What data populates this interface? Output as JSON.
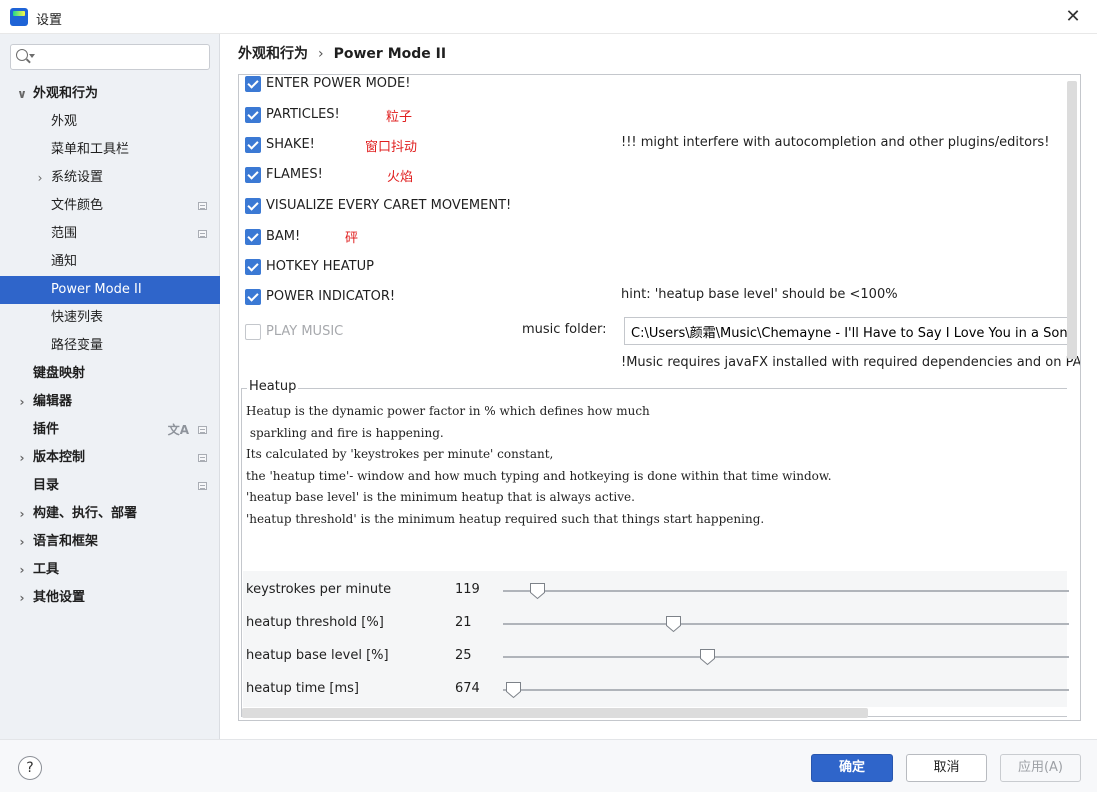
{
  "window": {
    "title": "设置",
    "close_icon": "close-icon"
  },
  "search": {
    "placeholder": "",
    "value": ""
  },
  "sidebar": {
    "items": [
      {
        "label": "外观和行为",
        "level": 0,
        "expanded": true,
        "bold": true
      },
      {
        "label": "外观",
        "level": 1
      },
      {
        "label": "菜单和工具栏",
        "level": 1
      },
      {
        "label": "系统设置",
        "level": 1,
        "collapsed": true
      },
      {
        "label": "文件颜色",
        "level": 1,
        "badge": true
      },
      {
        "label": "范围",
        "level": 1,
        "badge": true
      },
      {
        "label": "通知",
        "level": 1
      },
      {
        "label": "Power Mode II",
        "level": 1,
        "selected": true
      },
      {
        "label": "快速列表",
        "level": 1
      },
      {
        "label": "路径变量",
        "level": 1
      },
      {
        "label": "键盘映射",
        "level": 0,
        "bold": true
      },
      {
        "label": "编辑器",
        "level": 0,
        "collapsed": true,
        "bold": true
      },
      {
        "label": "插件",
        "level": 0,
        "bold": true,
        "badge": true,
        "translate_icon": "文A"
      },
      {
        "label": "版本控制",
        "level": 0,
        "collapsed": true,
        "bold": true,
        "badge": true
      },
      {
        "label": "目录",
        "level": 0,
        "bold": true,
        "badge": true
      },
      {
        "label": "构建、执行、部署",
        "level": 0,
        "collapsed": true,
        "bold": true
      },
      {
        "label": "语言和框架",
        "level": 0,
        "collapsed": true,
        "bold": true
      },
      {
        "label": "工具",
        "level": 0,
        "collapsed": true,
        "bold": true
      },
      {
        "label": "其他设置",
        "level": 0,
        "collapsed": true,
        "bold": true
      }
    ]
  },
  "breadcrumb": {
    "parent": "外观和行为",
    "separator": "›",
    "current": "Power Mode II"
  },
  "options": {
    "enter_power_mode": {
      "label": "ENTER POWER MODE!",
      "checked": true
    },
    "particles": {
      "label": "PARTICLES!",
      "checked": true,
      "annotation": "粒子"
    },
    "shake": {
      "label": "SHAKE!",
      "checked": true,
      "annotation": "窗口抖动",
      "note": "!!! might interfere with autocompletion and other plugins/editors!"
    },
    "flames": {
      "label": "FLAMES!",
      "checked": true,
      "annotation": "火焰"
    },
    "visualize_caret": {
      "label": "VISUALIZE EVERY CARET MOVEMENT!",
      "checked": true
    },
    "bam": {
      "label": "BAM!",
      "checked": true,
      "annotation": "砰"
    },
    "hotkey_heatup": {
      "label": "HOTKEY HEATUP",
      "checked": true
    },
    "power_indicator": {
      "label": "POWER INDICATOR!",
      "checked": true,
      "note": "hint: 'heatup base level' should be <100%"
    },
    "play_music": {
      "label": "PLAY MUSIC",
      "checked": false,
      "disabled": true
    }
  },
  "music": {
    "folder_label": "music folder:",
    "folder_value": "C:\\Users\\颜霜\\Music\\Chemayne - I'll Have to Say I Love You in a Song",
    "note": "!Music requires javaFX installed with required dependencies and on PATH"
  },
  "heatup": {
    "title": "Heatup",
    "description": [
      "Heatup is the dynamic power factor in % which defines how much",
      " sparkling and fire is happening.",
      "Its calculated by 'keystrokes per minute' constant,",
      "the 'heatup time'- window and how much typing and hotkeying is done within that time window.",
      "'heatup base level' is the minimum heatup that is always active.",
      "'heatup threshold' is the minimum heatup required such that things start happening."
    ],
    "sliders": [
      {
        "label": "keystrokes per minute",
        "value": "119",
        "position": 0.06
      },
      {
        "label": "heatup threshold [%]",
        "value": "21",
        "position": 0.3
      },
      {
        "label": "heatup base level [%]",
        "value": "25",
        "position": 0.36
      },
      {
        "label": "heatup time [ms]",
        "value": "674",
        "position": 0.017
      }
    ]
  },
  "footer": {
    "help_label": "?",
    "ok_label": "确定",
    "cancel_label": "取消",
    "apply_label": "应用(A)"
  },
  "colors": {
    "accent": "#2f65ca",
    "checkbox": "#3b79d4",
    "annotation": "#e02020",
    "sidebar_bg": "#eef1f5"
  }
}
